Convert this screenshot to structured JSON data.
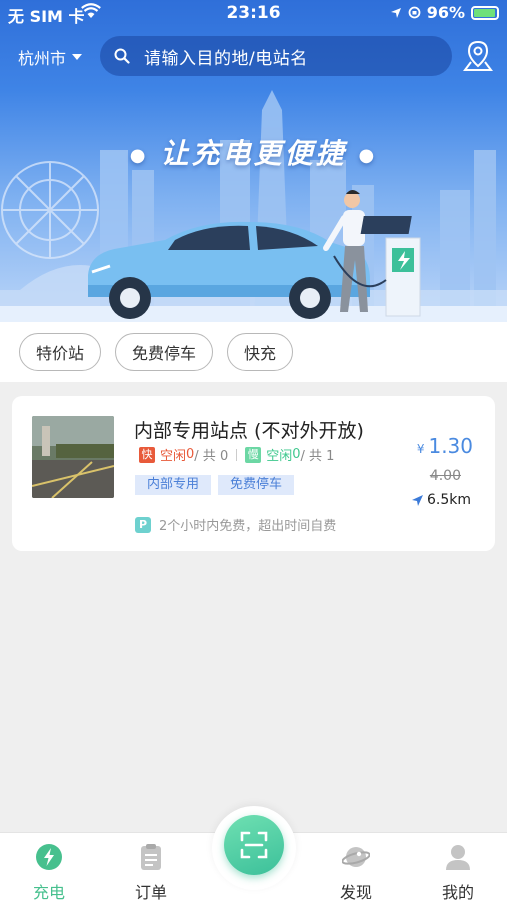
{
  "status_bar": {
    "carrier": "无 SIM 卡",
    "time": "23:16",
    "battery": "96%"
  },
  "header": {
    "city": "杭州市",
    "search_placeholder": "请输入目的地/电站名"
  },
  "banner": {
    "slogan": "让充电更便捷"
  },
  "filters": [
    "特价站",
    "免费停车",
    "快充"
  ],
  "station": {
    "name": "内部专用站点 (不对外开放)",
    "fast_tag": "快",
    "slow_tag": "慢",
    "fast_idle_label": "空闲",
    "fast_idle": "0",
    "fast_total": "/ 共 0",
    "slow_idle_label": "空闲",
    "slow_idle": "0",
    "slow_total": "/ 共 1",
    "tags": [
      "内部专用",
      "免费停车"
    ],
    "parking_icon": "P",
    "parking_note": "2个小时内免费，超出时间自费",
    "currency": "¥",
    "price": "1.30",
    "original_price": "4.00",
    "distance": "6.5km"
  },
  "tabs": {
    "charge": "充电",
    "orders": "订单",
    "discover": "发现",
    "mine": "我的"
  },
  "colors": {
    "accent": "#47c08e",
    "price": "#4a8ae0",
    "fast": "#e85a3a",
    "slow": "#6cd7a4"
  }
}
